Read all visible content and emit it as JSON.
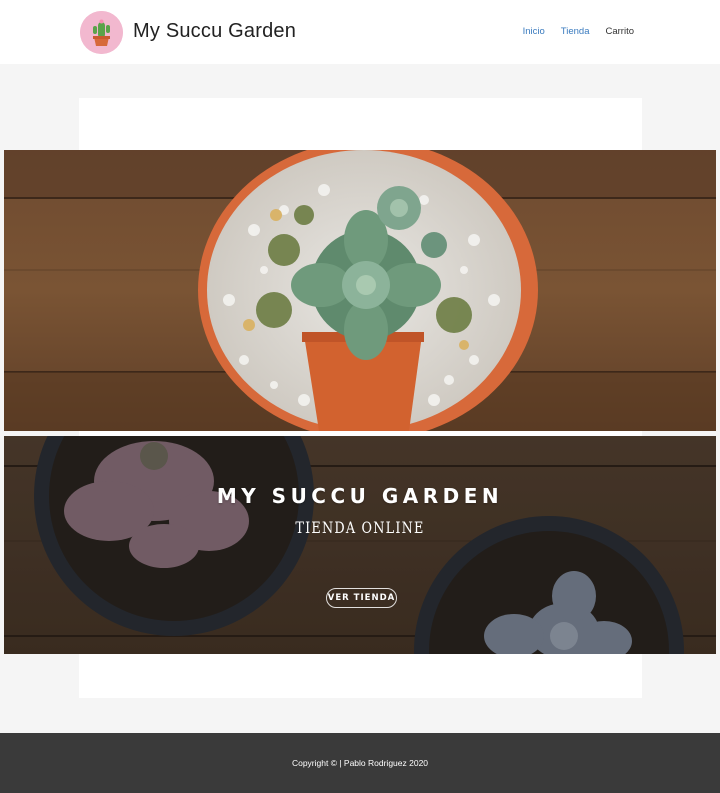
{
  "header": {
    "brand": "My Succu Garden",
    "logo_icon": "cactus-pot-icon",
    "nav": [
      {
        "label": "Inicio",
        "active": true
      },
      {
        "label": "Tienda",
        "active": true
      },
      {
        "label": "Carrito",
        "active": false
      }
    ]
  },
  "hero": {
    "title": "MY SUCCU GARDEN",
    "subtitle": "TIENDA ONLINE",
    "button_label": "VER TIENDA"
  },
  "footer": {
    "copyright": "Copyright © | Pablo Rodriguez 2020"
  },
  "colors": {
    "link_active": "#3a7bbf",
    "footer_bg": "#3a3a3a",
    "wood": "#6b4a32",
    "pot": "#d7693a",
    "logo_bg": "#f2b8cf"
  }
}
